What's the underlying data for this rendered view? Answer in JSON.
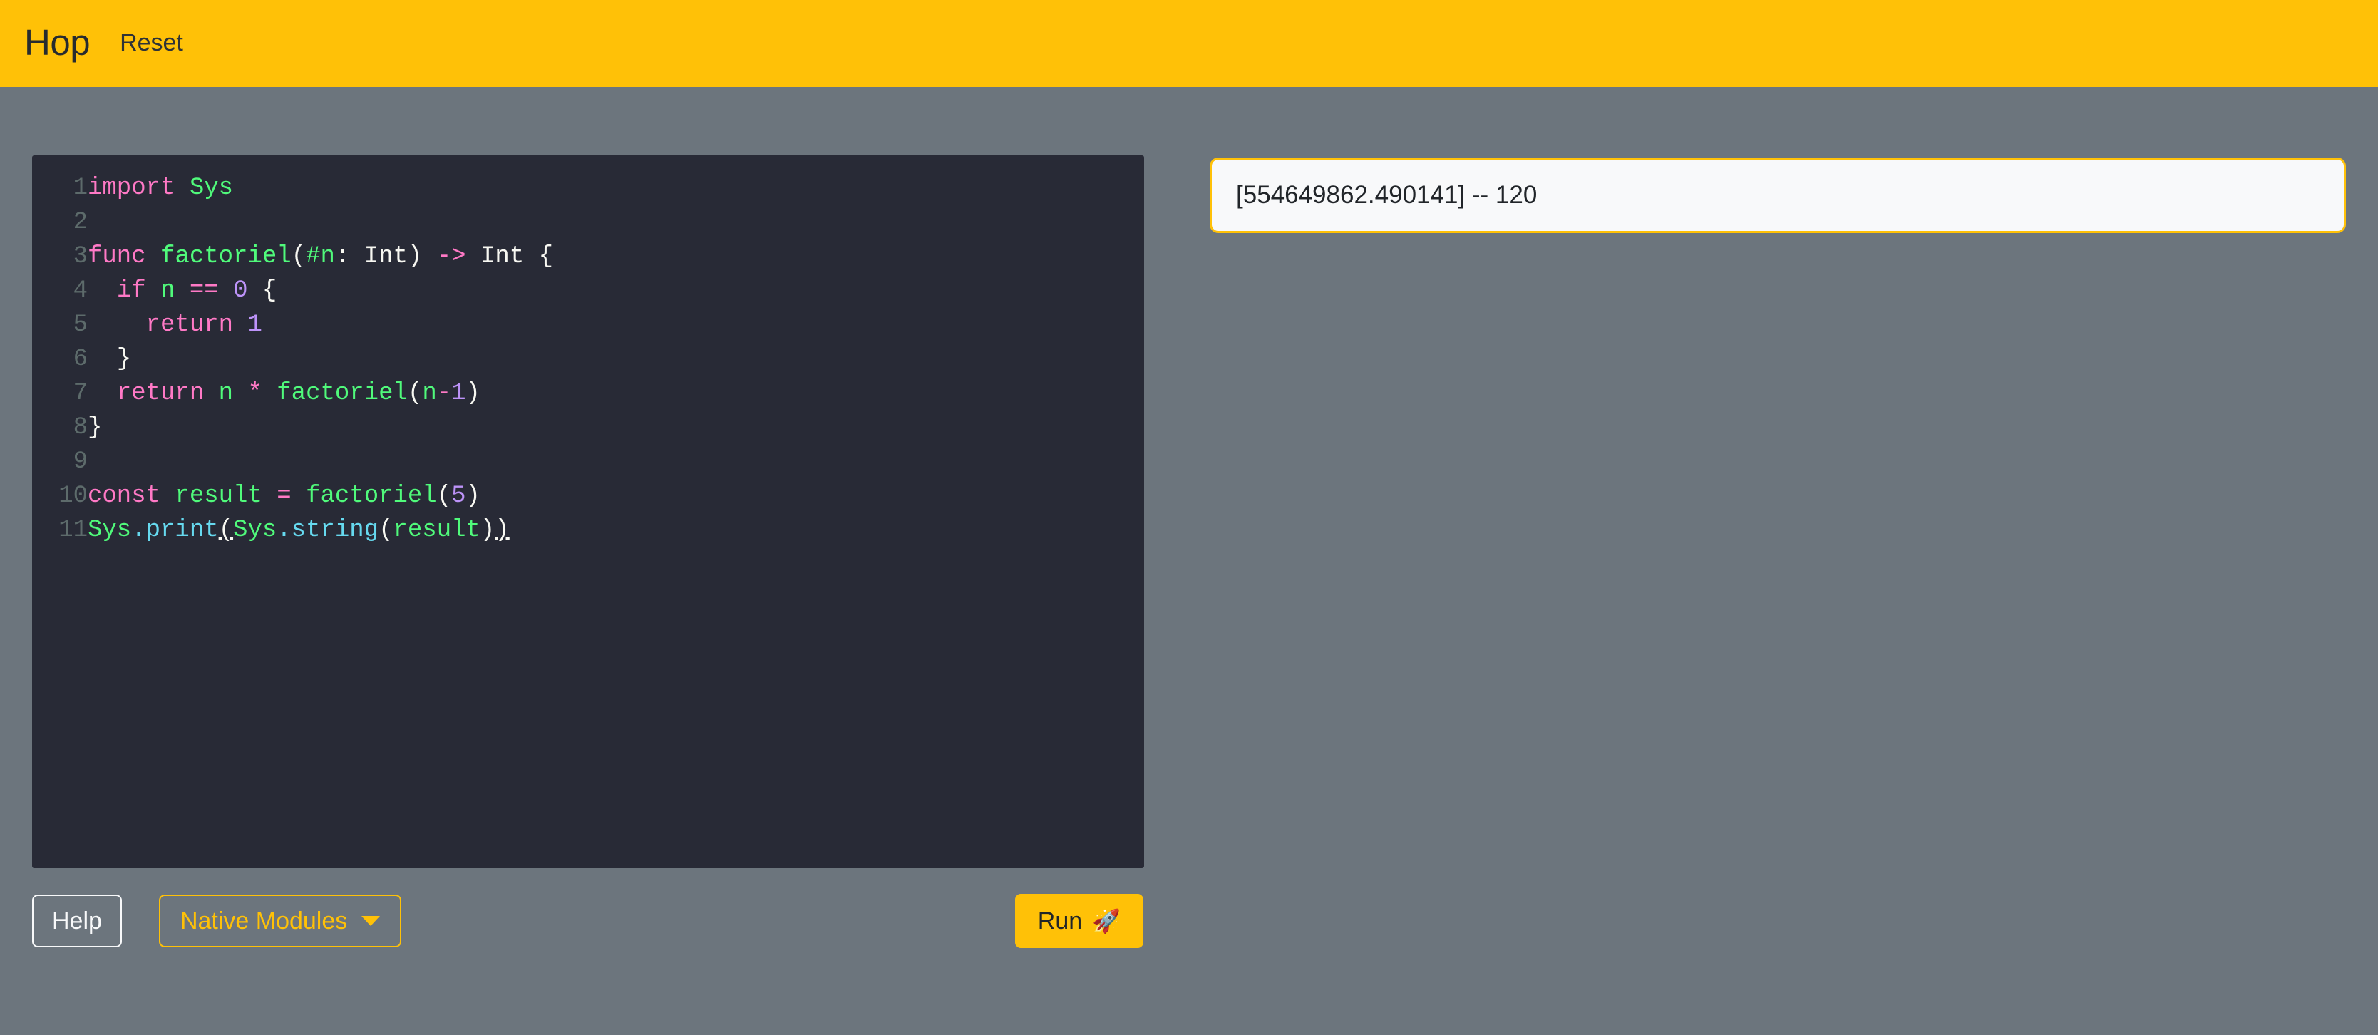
{
  "header": {
    "brand": "Hop",
    "reset_label": "Reset",
    "background_color": "#ffc107",
    "text_color": "#272b2f"
  },
  "theme": {
    "page_background": "#6c757d",
    "accent": "#ffc107",
    "editor_background": "#282a36",
    "output_background": "#f8f9fa"
  },
  "editor": {
    "language": "hop",
    "line_count": 11,
    "lines": [
      {
        "number": "1",
        "text": "import Sys"
      },
      {
        "number": "2",
        "text": ""
      },
      {
        "number": "3",
        "text": "func factoriel(#n: Int) -> Int {"
      },
      {
        "number": "4",
        "text": "  if n == 0 {"
      },
      {
        "number": "5",
        "text": "    return 1"
      },
      {
        "number": "6",
        "text": "  }"
      },
      {
        "number": "7",
        "text": "  return n * factoriel(n-1)"
      },
      {
        "number": "8",
        "text": "}"
      },
      {
        "number": "9",
        "text": ""
      },
      {
        "number": "10",
        "text": "const result = factoriel(5)"
      },
      {
        "number": "11",
        "text": "Sys.print(Sys.string(result))"
      }
    ],
    "source": "import Sys\n\nfunc factoriel(#n: Int) -> Int {\n  if n == 0 {\n    return 1\n  }\n  return n * factoriel(n-1)\n}\n\nconst result = factoriel(5)\nSys.print(Sys.string(result))"
  },
  "toolbar": {
    "help_label": "Help",
    "native_modules_label": "Native Modules",
    "native_modules_caret": "chevron-down-icon",
    "run_label": "Run",
    "run_icon": "rocket-icon",
    "run_icon_glyph": "🚀"
  },
  "output": {
    "text": "[554649862.490141] -- 120",
    "timestamp": "554649862.490141",
    "separator": "--",
    "value": "120"
  }
}
